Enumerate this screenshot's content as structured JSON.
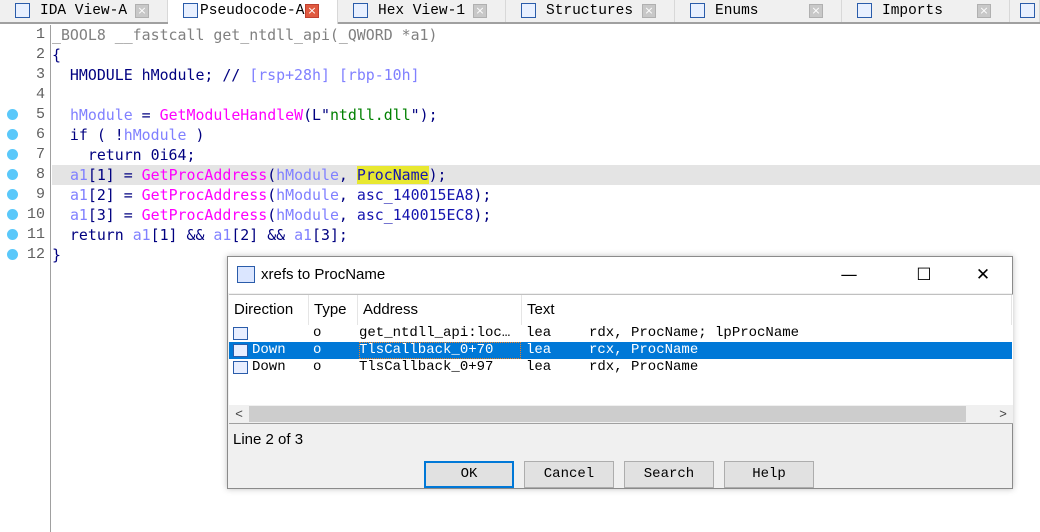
{
  "tabs": [
    {
      "label": "IDA View-A",
      "icon": "ida-view-icon",
      "active": false
    },
    {
      "label": "Pseudocode-A",
      "icon": "pseudocode-icon",
      "active": true
    },
    {
      "label": "Hex View-1",
      "icon": "hex-view-icon",
      "active": false
    },
    {
      "label": "Structures",
      "icon": "structures-icon",
      "active": false
    },
    {
      "label": "Enums",
      "icon": "enums-icon",
      "active": false
    },
    {
      "label": "Imports",
      "icon": "imports-icon",
      "active": false
    }
  ],
  "close_glyph": "×",
  "code": [
    {
      "n": "1",
      "bp": false,
      "hl": false,
      "tokens": [
        [
          "_BOOL8 __fastcall get_ntdll_api(_QWORD *a1)",
          "gray"
        ]
      ]
    },
    {
      "n": "2",
      "bp": false,
      "hl": false,
      "tokens": [
        [
          "{",
          ""
        ]
      ]
    },
    {
      "n": "3",
      "bp": false,
      "hl": false,
      "tokens": [
        [
          "  HMODULE hModule; // ",
          ""
        ],
        [
          "[rsp+28h] [rbp-10h]",
          "cmt"
        ]
      ]
    },
    {
      "n": "4",
      "bp": false,
      "hl": false,
      "tokens": []
    },
    {
      "n": "5",
      "bp": true,
      "hl": false,
      "tokens": [
        [
          "  ",
          ""
        ],
        [
          "hModule",
          "var"
        ],
        [
          " = ",
          ""
        ],
        [
          "GetModuleHandleW",
          "fn"
        ],
        [
          "(L\"",
          ""
        ],
        [
          "ntdll.dll",
          "str"
        ],
        [
          "\");",
          ""
        ]
      ]
    },
    {
      "n": "6",
      "bp": true,
      "hl": false,
      "tokens": [
        [
          "  if ( !",
          ""
        ],
        [
          "hModule",
          "var"
        ],
        [
          " )",
          ""
        ]
      ]
    },
    {
      "n": "7",
      "bp": true,
      "hl": false,
      "tokens": [
        [
          "    return 0i64;",
          ""
        ]
      ]
    },
    {
      "n": "8",
      "bp": true,
      "hl": true,
      "tokens": [
        [
          "  ",
          ""
        ],
        [
          "a1",
          "var"
        ],
        [
          "[1] = ",
          ""
        ],
        [
          "GetProcAddress",
          "fn"
        ],
        [
          "(",
          ""
        ],
        [
          "hModule",
          "var"
        ],
        [
          ", ",
          ""
        ],
        [
          "ProcName",
          "sel"
        ],
        [
          ");",
          ""
        ]
      ]
    },
    {
      "n": "9",
      "bp": true,
      "hl": false,
      "tokens": [
        [
          "  ",
          ""
        ],
        [
          "a1",
          "var"
        ],
        [
          "[2] = ",
          ""
        ],
        [
          "GetProcAddress",
          "fn"
        ],
        [
          "(",
          ""
        ],
        [
          "hModule",
          "var"
        ],
        [
          ", ",
          ""
        ],
        [
          "asc_140015EA8",
          "glob"
        ],
        [
          ");",
          ""
        ]
      ]
    },
    {
      "n": "10",
      "bp": true,
      "hl": false,
      "tokens": [
        [
          "  ",
          ""
        ],
        [
          "a1",
          "var"
        ],
        [
          "[3] = ",
          ""
        ],
        [
          "GetProcAddress",
          "fn"
        ],
        [
          "(",
          ""
        ],
        [
          "hModule",
          "var"
        ],
        [
          ", ",
          ""
        ],
        [
          "asc_140015EC8",
          "glob"
        ],
        [
          ");",
          ""
        ]
      ]
    },
    {
      "n": "11",
      "bp": true,
      "hl": false,
      "tokens": [
        [
          "  return ",
          ""
        ],
        [
          "a1",
          "var"
        ],
        [
          "[1] && ",
          ""
        ],
        [
          "a1",
          "var"
        ],
        [
          "[2] && ",
          ""
        ],
        [
          "a1",
          "var"
        ],
        [
          "[3];",
          ""
        ]
      ]
    },
    {
      "n": "12",
      "bp": true,
      "hl": false,
      "tokens": [
        [
          "}",
          ""
        ]
      ]
    }
  ],
  "dialog": {
    "title": "xrefs to ProcName",
    "minimize": "—",
    "maximize": "☐",
    "close": "✕",
    "columns": [
      "Direction",
      "Type",
      "Address",
      "Text"
    ],
    "rows": [
      {
        "direction": "",
        "type": "o",
        "address": "get_ntdll_api:loc…",
        "mnem": "lea",
        "ops": "rdx, ProcName; lpProcName",
        "selected": false
      },
      {
        "direction": "Down",
        "type": "o",
        "address": "TlsCallback_0+70",
        "mnem": "lea",
        "ops": "rcx, ProcName",
        "selected": true
      },
      {
        "direction": "Down",
        "type": "o",
        "address": "TlsCallback_0+97",
        "mnem": "lea",
        "ops": "rdx, ProcName",
        "selected": false
      }
    ],
    "scroll_left": "<",
    "scroll_right": ">",
    "status": "Line 2 of 3",
    "buttons": {
      "ok": "OK",
      "cancel": "Cancel",
      "search": "Search",
      "help": "Help"
    }
  }
}
